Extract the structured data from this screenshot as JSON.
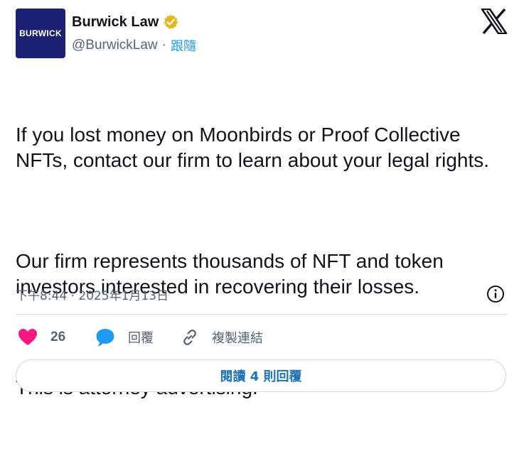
{
  "author": {
    "avatar_text": "BURWICK",
    "display_name": "Burwick Law",
    "verified_icon": "verified-badge-gold-icon",
    "handle": "@BurwickLaw",
    "separator": "·",
    "follow_label": "跟隨"
  },
  "platform": {
    "logo_icon": "x-logo-icon"
  },
  "tweet": {
    "paragraphs": [
      "If you lost money on Moonbirds or Proof Collective NFTs, contact our firm to learn about your legal rights.",
      "Our firm represents thousands of NFT and token investors interested in recovering their losses.",
      "This is attorney advertising."
    ],
    "timestamp": "下午8:44 · 2025年1月13日",
    "info_icon": "info-icon"
  },
  "actions": {
    "like_count": "26",
    "like_icon": "heart-icon",
    "reply_label": "回覆",
    "reply_icon": "speech-bubble-icon",
    "copy_label": "複製連結",
    "copy_icon": "link-icon"
  },
  "replies_button": {
    "label": "閱讀 4 則回覆"
  },
  "colors": {
    "accent": "#1d9bf0",
    "like": "#f91880",
    "avatar_bg": "#1c2173",
    "verified": "#e2b719",
    "muted_text": "#536471",
    "divider": "#cfd9de"
  }
}
